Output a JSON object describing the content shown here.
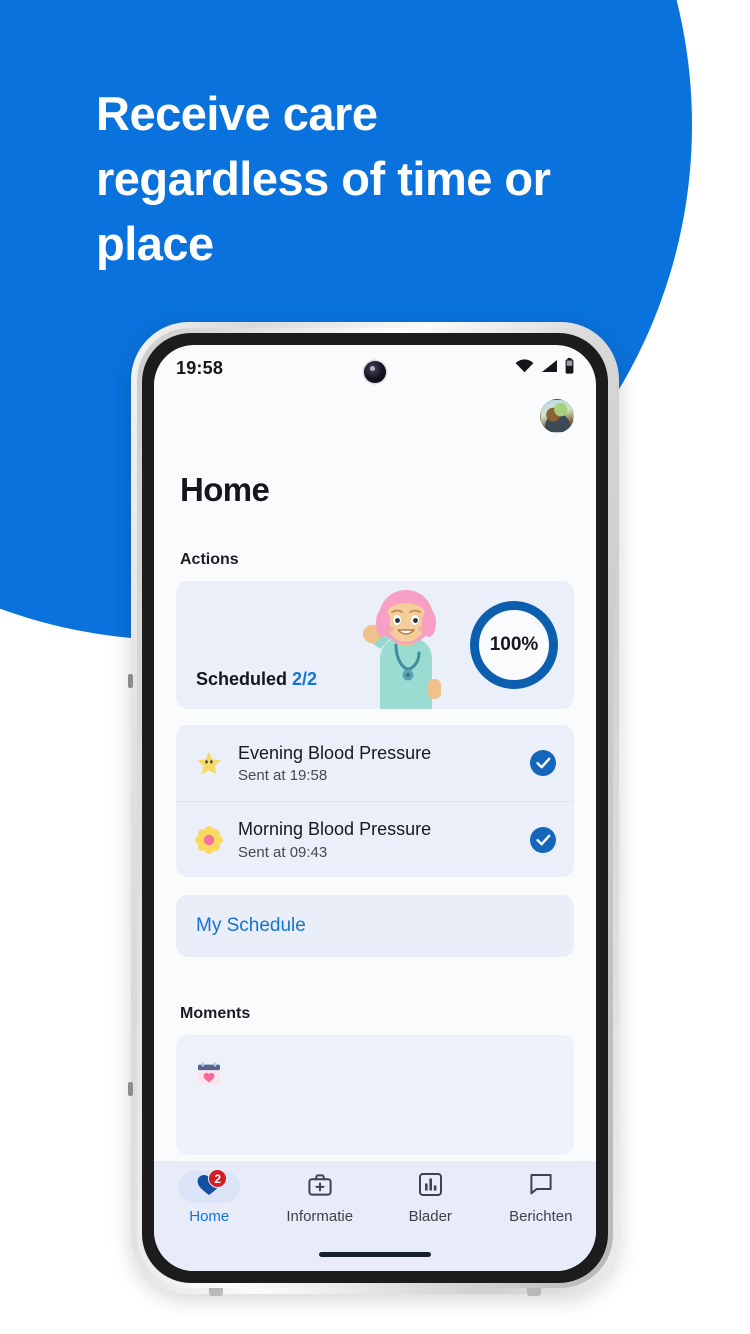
{
  "promo": {
    "headline": "Receive care regardless of time or place",
    "background_color": "#0a72dc"
  },
  "phone": {
    "status_bar": {
      "time": "19:58",
      "wifi_icon": "wifi-icon",
      "signal_icon": "cellular-signal-icon",
      "battery_icon": "battery-icon"
    },
    "camera_icon": "front-camera-icon",
    "home_indicator": "home-indicator"
  },
  "app": {
    "avatar_icon": "profile-avatar",
    "page_title": "Home",
    "sections": {
      "actions_label": "Actions",
      "moments_label": "Moments"
    },
    "progress_card": {
      "label": "Scheduled",
      "count": "2/2",
      "percent": "100%",
      "illustration": "nurse-illustration",
      "accent_color": "#1473d6",
      "ring_color": "#0b5fae"
    },
    "tasks": [
      {
        "emoji": "🌟",
        "emoji_name": "glowing-star-icon",
        "title": "Evening Blood Pressure",
        "subtitle": "Sent at 19:58",
        "status_icon": "check-circle-icon"
      },
      {
        "emoji": "🌼",
        "emoji_name": "blossom-icon",
        "title": "Morning Blood Pressure",
        "subtitle": "Sent at 09:43",
        "status_icon": "check-circle-icon"
      }
    ],
    "schedule_button": {
      "label": "My Schedule"
    },
    "moments_card": {
      "emoji": "📅",
      "emoji_name": "calendar-heart-icon"
    },
    "bottom_nav": [
      {
        "label": "Home",
        "icon": "heart-icon",
        "badge": "2",
        "active": true
      },
      {
        "label": "Informatie",
        "icon": "medical-bag-icon",
        "badge": null,
        "active": false
      },
      {
        "label": "Blader",
        "icon": "bar-chart-icon",
        "badge": null,
        "active": false
      },
      {
        "label": "Berichten",
        "icon": "chat-bubble-icon",
        "badge": null,
        "active": false
      }
    ]
  }
}
